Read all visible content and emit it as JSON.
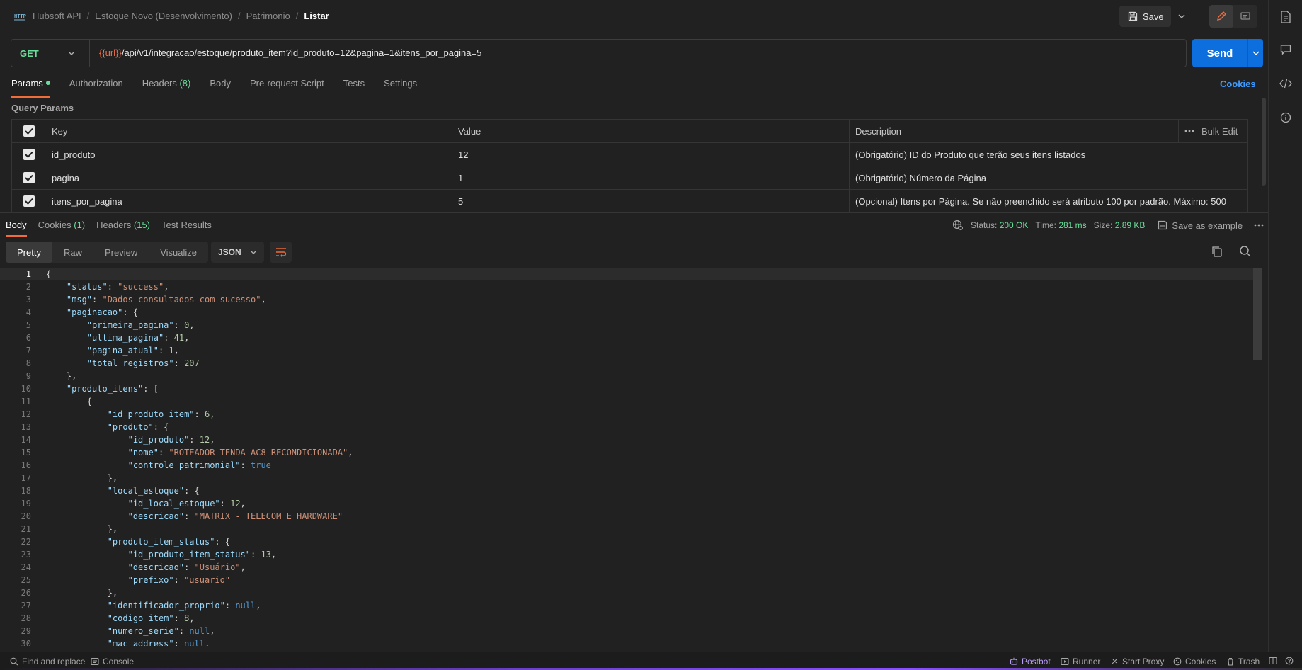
{
  "header": {
    "breadcrumb": [
      "Hubsoft API",
      "Estoque Novo (Desenvolvimento)",
      "Patrimonio"
    ],
    "current": "Listar",
    "save_label": "Save"
  },
  "request": {
    "method": "GET",
    "url_variable": "{{url}}",
    "url_path": "/api/v1/integracao/estoque/produto_item?id_produto=12&pagina=1&itens_por_pagina=5",
    "send_label": "Send",
    "tabs": {
      "params": "Params",
      "authorization": "Authorization",
      "headers": "Headers",
      "headers_count": "(8)",
      "body": "Body",
      "prerequest": "Pre-request Script",
      "tests": "Tests",
      "settings": "Settings"
    },
    "cookies_label": "Cookies"
  },
  "query_params": {
    "title": "Query Params",
    "columns": {
      "key": "Key",
      "value": "Value",
      "description": "Description"
    },
    "bulk_edit": "Bulk Edit",
    "rows": [
      {
        "key": "id_produto",
        "value": "12",
        "description": "(Obrigatório) ID do Produto que terão seus itens listados"
      },
      {
        "key": "pagina",
        "value": "1",
        "description": "(Obrigatório) Número da Página"
      },
      {
        "key": "itens_por_pagina",
        "value": "5",
        "description": "(Opcional) Itens por Página. Se não preenchido será atributo 100 por padrão. Máximo: 500"
      }
    ]
  },
  "response": {
    "tabs": {
      "body": "Body",
      "cookies": "Cookies",
      "cookies_count": "(1)",
      "headers": "Headers",
      "headers_count": "(15)",
      "test_results": "Test Results"
    },
    "status_label": "Status:",
    "status_value": "200 OK",
    "time_label": "Time:",
    "time_value": "281 ms",
    "size_label": "Size:",
    "size_value": "2.89 KB",
    "save_example": "Save as example",
    "views": {
      "pretty": "Pretty",
      "raw": "Raw",
      "preview": "Preview",
      "visualize": "Visualize"
    },
    "format": "JSON"
  },
  "code_lines": [
    [
      1,
      0,
      [
        [
          "p",
          "{"
        ]
      ]
    ],
    [
      2,
      1,
      [
        [
          "k",
          "\"status\""
        ],
        [
          "p",
          ": "
        ],
        [
          "s",
          "\"success\""
        ],
        [
          "p",
          ","
        ]
      ]
    ],
    [
      3,
      1,
      [
        [
          "k",
          "\"msg\""
        ],
        [
          "p",
          ": "
        ],
        [
          "s",
          "\"Dados consultados com sucesso\""
        ],
        [
          "p",
          ","
        ]
      ]
    ],
    [
      4,
      1,
      [
        [
          "k",
          "\"paginacao\""
        ],
        [
          "p",
          ": {"
        ]
      ]
    ],
    [
      5,
      2,
      [
        [
          "k",
          "\"primeira_pagina\""
        ],
        [
          "p",
          ": "
        ],
        [
          "n",
          "0"
        ],
        [
          "p",
          ","
        ]
      ]
    ],
    [
      6,
      2,
      [
        [
          "k",
          "\"ultima_pagina\""
        ],
        [
          "p",
          ": "
        ],
        [
          "n",
          "41"
        ],
        [
          "p",
          ","
        ]
      ]
    ],
    [
      7,
      2,
      [
        [
          "k",
          "\"pagina_atual\""
        ],
        [
          "p",
          ": "
        ],
        [
          "n",
          "1"
        ],
        [
          "p",
          ","
        ]
      ]
    ],
    [
      8,
      2,
      [
        [
          "k",
          "\"total_registros\""
        ],
        [
          "p",
          ": "
        ],
        [
          "n",
          "207"
        ]
      ]
    ],
    [
      9,
      1,
      [
        [
          "p",
          "},"
        ]
      ]
    ],
    [
      10,
      1,
      [
        [
          "k",
          "\"produto_itens\""
        ],
        [
          "p",
          ": ["
        ]
      ]
    ],
    [
      11,
      2,
      [
        [
          "p",
          "{"
        ]
      ]
    ],
    [
      12,
      3,
      [
        [
          "k",
          "\"id_produto_item\""
        ],
        [
          "p",
          ": "
        ],
        [
          "n",
          "6"
        ],
        [
          "p",
          ","
        ]
      ]
    ],
    [
      13,
      3,
      [
        [
          "k",
          "\"produto\""
        ],
        [
          "p",
          ": {"
        ]
      ]
    ],
    [
      14,
      4,
      [
        [
          "k",
          "\"id_produto\""
        ],
        [
          "p",
          ": "
        ],
        [
          "n",
          "12"
        ],
        [
          "p",
          ","
        ]
      ]
    ],
    [
      15,
      4,
      [
        [
          "k",
          "\"nome\""
        ],
        [
          "p",
          ": "
        ],
        [
          "s",
          "\"ROTEADOR TENDA AC8 RECONDICIONADA\""
        ],
        [
          "p",
          ","
        ]
      ]
    ],
    [
      16,
      4,
      [
        [
          "k",
          "\"controle_patrimonial\""
        ],
        [
          "p",
          ": "
        ],
        [
          "b",
          "true"
        ]
      ]
    ],
    [
      17,
      3,
      [
        [
          "p",
          "},"
        ]
      ]
    ],
    [
      18,
      3,
      [
        [
          "k",
          "\"local_estoque\""
        ],
        [
          "p",
          ": {"
        ]
      ]
    ],
    [
      19,
      4,
      [
        [
          "k",
          "\"id_local_estoque\""
        ],
        [
          "p",
          ": "
        ],
        [
          "n",
          "12"
        ],
        [
          "p",
          ","
        ]
      ]
    ],
    [
      20,
      4,
      [
        [
          "k",
          "\"descricao\""
        ],
        [
          "p",
          ": "
        ],
        [
          "s",
          "\"MATRIX - TELECOM E HARDWARE\""
        ]
      ]
    ],
    [
      21,
      3,
      [
        [
          "p",
          "},"
        ]
      ]
    ],
    [
      22,
      3,
      [
        [
          "k",
          "\"produto_item_status\""
        ],
        [
          "p",
          ": {"
        ]
      ]
    ],
    [
      23,
      4,
      [
        [
          "k",
          "\"id_produto_item_status\""
        ],
        [
          "p",
          ": "
        ],
        [
          "n",
          "13"
        ],
        [
          "p",
          ","
        ]
      ]
    ],
    [
      24,
      4,
      [
        [
          "k",
          "\"descricao\""
        ],
        [
          "p",
          ": "
        ],
        [
          "s",
          "\"Usuário\""
        ],
        [
          "p",
          ","
        ]
      ]
    ],
    [
      25,
      4,
      [
        [
          "k",
          "\"prefixo\""
        ],
        [
          "p",
          ": "
        ],
        [
          "s",
          "\"usuario\""
        ]
      ]
    ],
    [
      26,
      3,
      [
        [
          "p",
          "},"
        ]
      ]
    ],
    [
      27,
      3,
      [
        [
          "k",
          "\"identificador_proprio\""
        ],
        [
          "p",
          ": "
        ],
        [
          "b",
          "null"
        ],
        [
          "p",
          ","
        ]
      ]
    ],
    [
      28,
      3,
      [
        [
          "k",
          "\"codigo_item\""
        ],
        [
          "p",
          ": "
        ],
        [
          "n",
          "8"
        ],
        [
          "p",
          ","
        ]
      ]
    ],
    [
      29,
      3,
      [
        [
          "k",
          "\"numero_serie\""
        ],
        [
          "p",
          ": "
        ],
        [
          "b",
          "null"
        ],
        [
          "p",
          ","
        ]
      ]
    ],
    [
      30,
      3,
      [
        [
          "k",
          "\"mac_address\""
        ],
        [
          "p",
          ": "
        ],
        [
          "b",
          "null"
        ],
        [
          "p",
          ","
        ]
      ]
    ]
  ],
  "statusbar": {
    "find_replace": "Find and replace",
    "console": "Console",
    "postbot": "Postbot",
    "runner": "Runner",
    "start_proxy": "Start Proxy",
    "cookies": "Cookies",
    "trash": "Trash"
  }
}
